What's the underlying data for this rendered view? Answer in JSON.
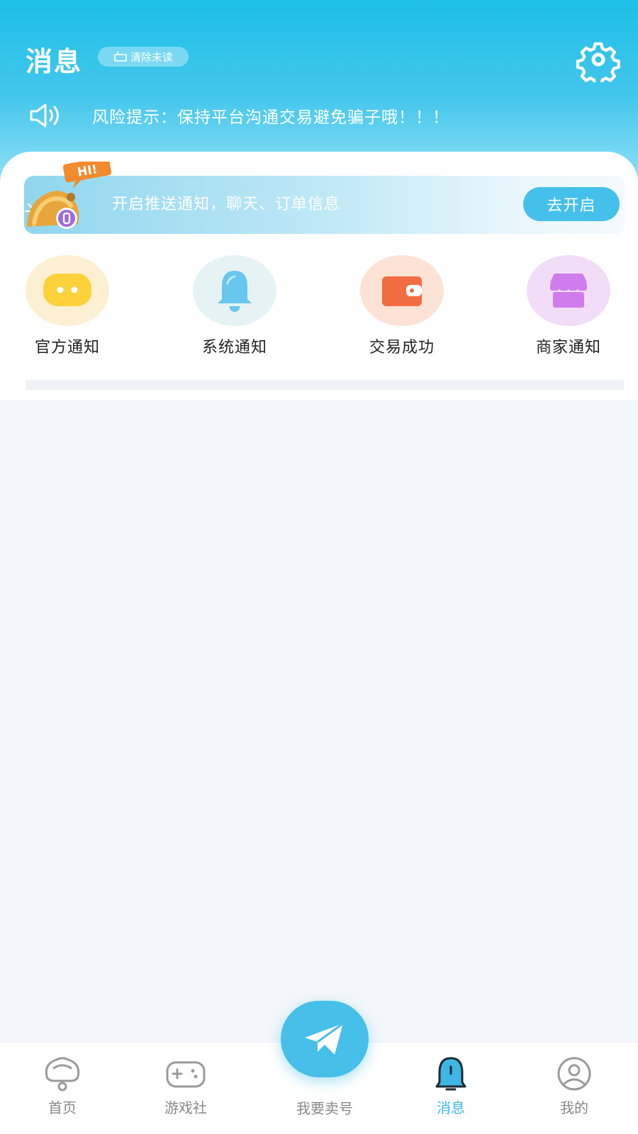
{
  "header": {
    "title": "消息",
    "clear_unread": "清除未读",
    "settings_icon": "gear-icon"
  },
  "risk_notice": {
    "text": "风险提示：保持平台沟通交易避免骗子哦！！！",
    "icon": "speaker-icon"
  },
  "push_banner": {
    "badge": "HI!",
    "text": "开启推送通知，聊天、订单信息",
    "button": "去开启"
  },
  "categories": [
    {
      "label": "官方通知",
      "icon": "chat-bubble-icon",
      "bg": "#fdf0d2",
      "color": "#fcd13a"
    },
    {
      "label": "系统通知",
      "icon": "bell-icon",
      "bg": "#e6f3f4",
      "color": "#69c6ef"
    },
    {
      "label": "交易成功",
      "icon": "wallet-icon",
      "bg": "#fde2d6",
      "color": "#f26c42"
    },
    {
      "label": "商家通知",
      "icon": "shop-icon",
      "bg": "#f1ddf8",
      "color": "#d07cee"
    }
  ],
  "tabbar": {
    "items": [
      {
        "label": "首页",
        "icon": "home-icon"
      },
      {
        "label": "游戏社",
        "icon": "gamepad-icon"
      },
      {
        "label": "我要卖号",
        "icon": "paper-plane-icon"
      },
      {
        "label": "消息",
        "icon": "message-bell-icon",
        "active": true
      },
      {
        "label": "我的",
        "icon": "profile-icon"
      }
    ],
    "active_color": "#3fb6e4"
  }
}
